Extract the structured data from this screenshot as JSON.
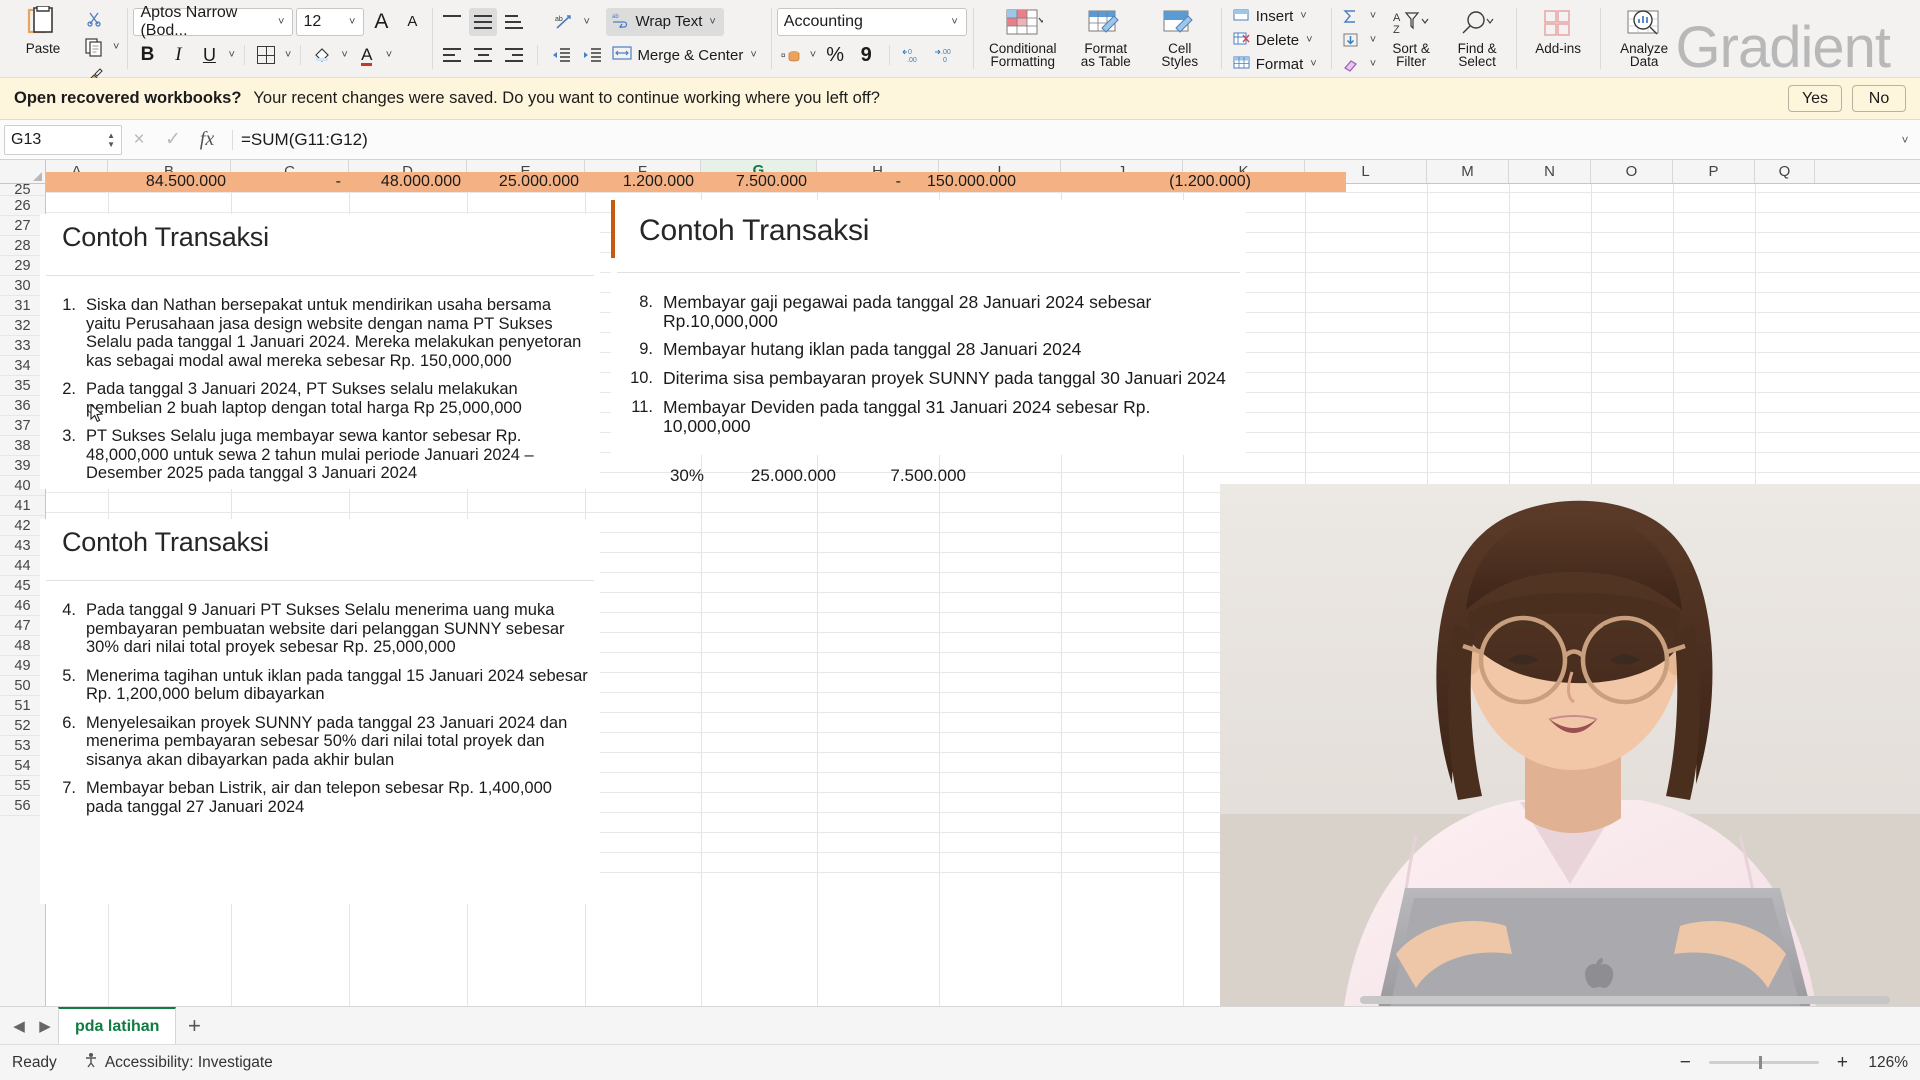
{
  "ribbon": {
    "paste_label": "Paste",
    "font_name": "Aptos Narrow (Bod...",
    "font_size": "12",
    "grow_font": "A",
    "shrink_font": "A",
    "bold": "B",
    "italic": "I",
    "underline": "U",
    "wrap_text": "Wrap Text",
    "merge_center": "Merge & Center",
    "number_format": "Accounting",
    "percent": "%",
    "comma": "9",
    "conditional_formatting_l1": "Conditional",
    "conditional_formatting_l2": "Formatting",
    "format_as_table_l1": "Format",
    "format_as_table_l2": "as Table",
    "cell_styles_l1": "Cell",
    "cell_styles_l2": "Styles",
    "insert": "Insert",
    "delete": "Delete",
    "format": "Format",
    "sort_filter_l1": "Sort &",
    "sort_filter_l2": "Filter",
    "find_select_l1": "Find &",
    "find_select_l2": "Select",
    "addins": "Add-ins",
    "analyze_data_l1": "Analyze",
    "analyze_data_l2": "Data"
  },
  "watermark": "Gradient",
  "banner": {
    "strong": "Open recovered workbooks?",
    "message": "Your recent changes were saved. Do you want to continue working where you left off?",
    "yes": "Yes",
    "no": "No"
  },
  "formula_bar": {
    "name_box": "G13",
    "cancel": "×",
    "confirm": "✓",
    "fx": "fx",
    "formula": "=SUM(G11:G12)"
  },
  "grid": {
    "columns": [
      "A",
      "B",
      "C",
      "D",
      "E",
      "F",
      "G",
      "H",
      "I",
      "J",
      "K",
      "L",
      "M",
      "N",
      "O",
      "P",
      "Q"
    ],
    "selected_column": "G",
    "rows": [
      "25",
      "26",
      "27",
      "28",
      "29",
      "30",
      "31",
      "32",
      "33",
      "34",
      "35",
      "36",
      "37",
      "38",
      "39",
      "40",
      "41",
      "42",
      "43",
      "44",
      "45",
      "46",
      "47",
      "48",
      "49",
      "50",
      "51",
      "52",
      "53",
      "54",
      "55",
      "56"
    ],
    "row25_values": [
      "84.500.000",
      "-",
      "48.000.000",
      "25.000.000",
      "1.200.000",
      "7.500.000",
      "-",
      "150.000.000",
      "(1.200.000)"
    ],
    "inline_values": [
      "30%",
      "25.000.000",
      "7.500.000"
    ]
  },
  "textboxes": [
    {
      "title": "Contoh Transaksi",
      "items": [
        {
          "num": "1.",
          "text": "Siska dan Nathan bersepakat untuk mendirikan usaha bersama yaitu Perusahaan jasa design website dengan nama PT Sukses Selalu pada tanggal 1 Januari 2024. Mereka melakukan penyetoran kas sebagai modal awal mereka sebesar Rp. 150,000,000"
        },
        {
          "num": "2.",
          "text": "Pada tanggal 3 Januari 2024, PT Sukses selalu melakukan pembelian 2 buah laptop dengan total harga Rp 25,000,000"
        },
        {
          "num": "3.",
          "text": "PT Sukses Selalu juga membayar sewa kantor sebesar Rp. 48,000,000 untuk sewa 2 tahun mulai periode Januari 2024 – Desember 2025 pada tanggal 3 Januari 2024"
        }
      ]
    },
    {
      "title": "Contoh Transaksi",
      "items": [
        {
          "num": "4.",
          "text": "Pada tanggal 9 Januari PT Sukses Selalu menerima uang muka pembayaran pembuatan website dari pelanggan SUNNY sebesar 30% dari nilai total proyek sebesar Rp. 25,000,000"
        },
        {
          "num": "5.",
          "text": "Menerima tagihan untuk iklan pada tanggal 15 Januari 2024 sebesar Rp. 1,200,000 belum dibayarkan"
        },
        {
          "num": "6.",
          "text": "Menyelesaikan proyek SUNNY pada tanggal 23 Januari 2024 dan menerima pembayaran sebesar 50% dari nilai total proyek dan sisanya akan dibayarkan pada akhir bulan"
        },
        {
          "num": "7.",
          "text": "Membayar beban Listrik, air dan telepon sebesar Rp. 1,400,000 pada tanggal 27 Januari 2024"
        }
      ]
    },
    {
      "title": "Contoh Transaksi",
      "items": [
        {
          "num": "8.",
          "text": "Membayar gaji pegawai pada tanggal 28 Januari 2024 sebesar Rp.10,000,000"
        },
        {
          "num": "9.",
          "text": "Membayar hutang iklan pada tanggal 28 Januari 2024"
        },
        {
          "num": "10.",
          "text": "Diterima sisa pembayaran proyek SUNNY pada tanggal 30 Januari 2024"
        },
        {
          "num": "11.",
          "text": "Membayar Deviden pada tanggal 31 Januari 2024 sebesar Rp. 10,000,000"
        }
      ]
    }
  ],
  "sheet": {
    "prev": "◀",
    "next": "▶",
    "tab_name": "pda latihan",
    "add": "+"
  },
  "status": {
    "ready": "Ready",
    "accessibility": "Accessibility: Investigate",
    "zoom_out": "−",
    "zoom_in": "+",
    "zoom": "126%"
  },
  "colors": {
    "accent_green": "#107c41",
    "banner_bg": "#fdf6dd",
    "row25_fill": "#f4b183",
    "textbox_accent": "#c55a11"
  }
}
